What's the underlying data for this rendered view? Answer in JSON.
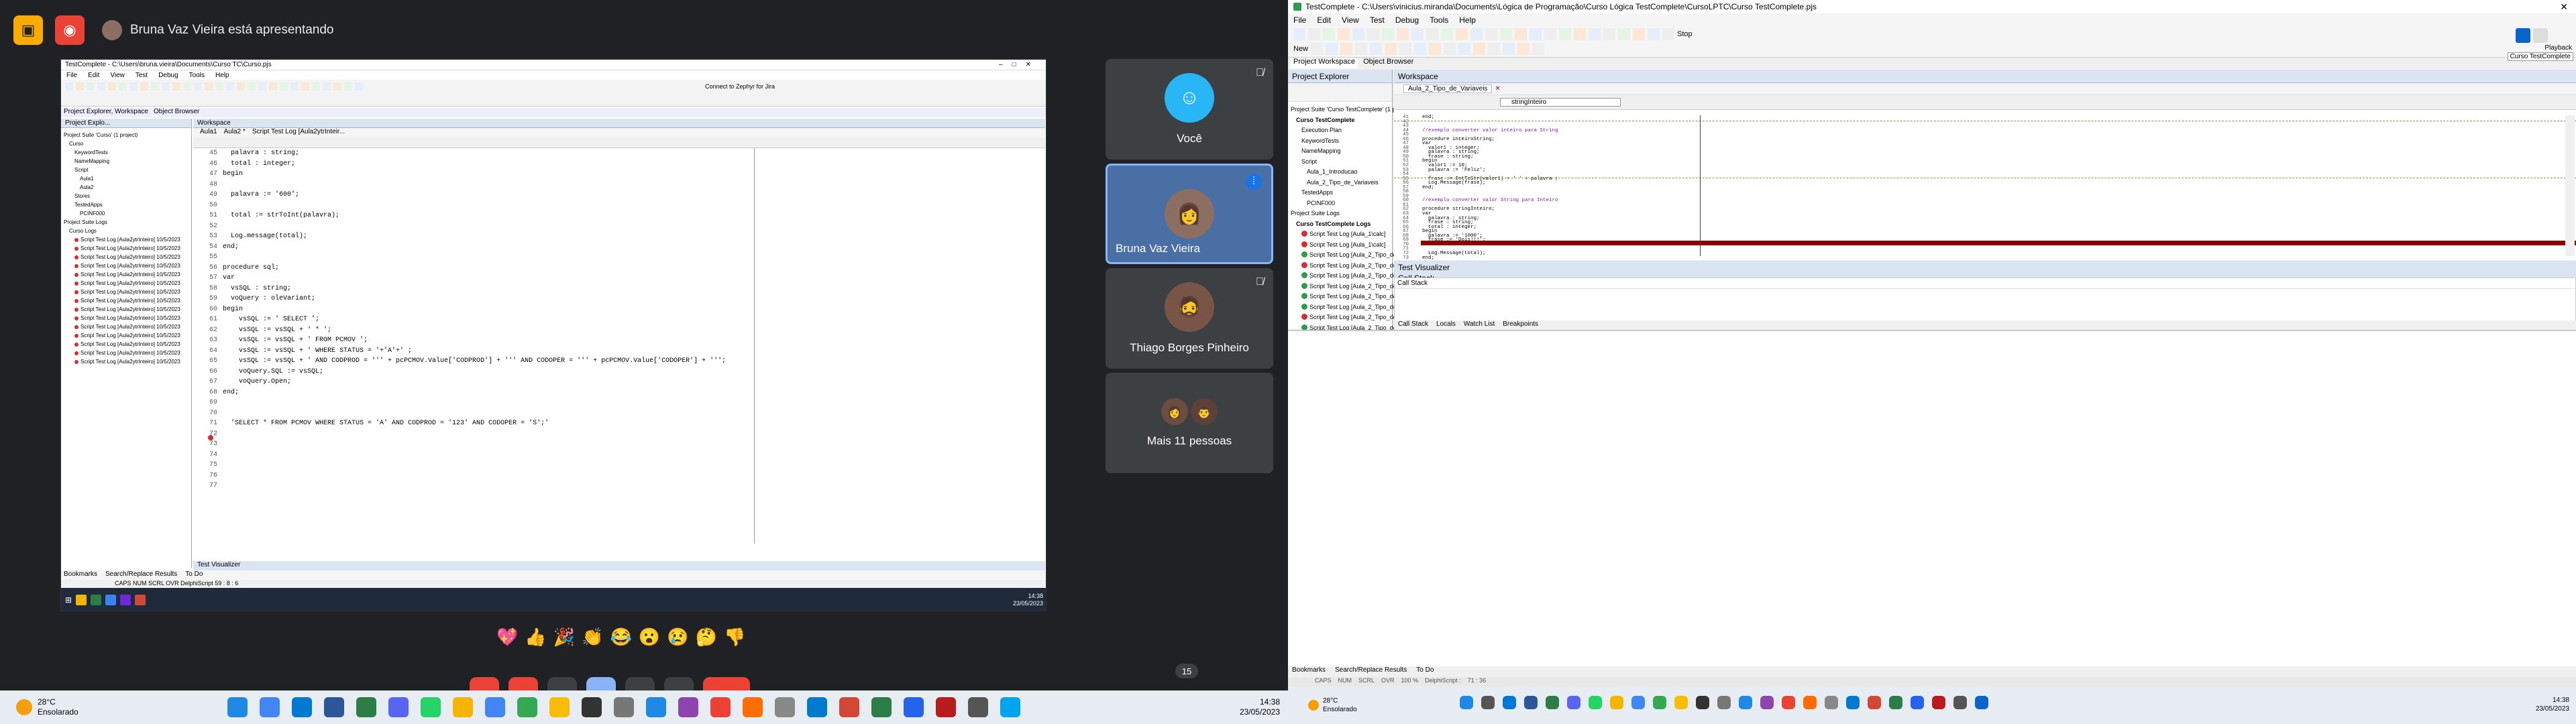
{
  "meet": {
    "presenter_text": "Bruna Vaz Vieira está apresentando",
    "tiles": [
      {
        "name": "Você",
        "muted": true
      },
      {
        "name": "Bruna Vaz Vieira",
        "muted": false
      },
      {
        "name": "Thiago Borges Pinheiro",
        "muted": true
      },
      {
        "name": "Mais 11 pessoas",
        "muted": false
      }
    ],
    "reactions": [
      "💖",
      "👍",
      "🎉",
      "👏",
      "😂",
      "😮",
      "😢",
      "🤔",
      "👎"
    ],
    "badge": "15"
  },
  "shared": {
    "title": "TestComplete - C:\\Users\\bruna.vieira\\Documents\\Curso TC\\Curso.pjs",
    "menu": [
      "File",
      "Edit",
      "View",
      "Test",
      "Debug",
      "Tools",
      "Help"
    ],
    "panel_left": "Project Explo...",
    "panel_right": "Workspace",
    "left_tabs": [
      "Project Explorer, Workspace",
      "Object Browser"
    ],
    "tabs": [
      "Aula1",
      "Aula2 *",
      "Script Test Log [Aula2ytrInteir..."
    ],
    "tree": [
      "Project Suite 'Curso' (1 project)",
      "Curso",
      "KeywordTests",
      "NameMapping",
      "Script",
      "Aula1",
      "Aula2",
      "Stores",
      "TestedApps",
      "PCINF000",
      "Project Suite Logs",
      "Curso Logs",
      "Script Test Log [Aula2ytrInteiro] 10/5/2023",
      "Script Test Log [Aula2ytrInteiro] 10/5/2023",
      "Script Test Log [Aula2ytrInteiro] 10/5/2023",
      "Script Test Log [Aula2ytrInteiro] 10/5/2023",
      "Script Test Log [Aula2ytrInteiro] 10/5/2023",
      "Script Test Log [Aula2ytrInteiro] 10/5/2023",
      "Script Test Log [Aula2ytrInteiro] 10/5/2023",
      "Script Test Log [Aula2ytrInteiro] 10/5/2023",
      "Script Test Log [Aula2ytrInteiro] 10/5/2023",
      "Script Test Log [Aula2ytrInteiro] 10/5/2023",
      "Script Test Log [Aula2ytrInteiro] 10/5/2023",
      "Script Test Log [Aula2ytrInteiro] 10/5/2023",
      "Script Test Log [Aula2ytrInteiro] 10/5/2023",
      "Script Test Log [Aula2ytrInteiro] 10/5/2023",
      "Script Test Log [Aula2ytrInteiro] 10/5/2023"
    ],
    "gutter": "45\n46\n47\n48\n49\n50\n51\n52\n53\n54\n55\n56\n57\n58\n59\n60\n61\n62\n63\n64\n65\n66\n67\n68\n69\n70\n71\n72\n73\n74\n75\n76\n77",
    "code": "  palavra : string;\n  total : integer;\nbegin\n\n  palavra := '600';\n\n  total := strToInt(palavra);\n\n  Log.message(total);\nend;\n\nprocedure sql;\nvar\n  vsSQL : string;\n  voQuery : oleVariant;\nbegin\n    vsSQL := ' SELECT ';\n    vsSQL := vsSQL + ' * ';\n    vsSQL := vsSQL + ' FROM PCMOV ';\n    vsSQL := vsSQL + ' WHERE STATUS = '+'A'+' ;\n    vsSQL := vsSQL + ' AND CODPROD = ''' + pcPCMOV.Value['CODPROD'] + ''' AND CODOPER = ''' + pcPCMOV.Value['CODOPER'] + ''';\n    voQuery.SQL := vsSQL;\n    voQuery.Open;\nend;\n\n\n  'SELECT * FROM PCMOV WHERE STATUS = 'A' AND CODPROD = '123' AND CODOPER = 'S';'\n\n\n\n",
    "bottom_tabs": [
      "Bookmarks",
      "Search/Replace Results",
      "To Do"
    ],
    "status": "CAPS  NUM  SCRL  OVR  DelphiScript  59 : 8 : 6",
    "visualizer": "Test Visualizer",
    "connect": "Connect to Zephyr for Jira",
    "time": "14:38",
    "date": "23/05/2023"
  },
  "testcomplete": {
    "title": "TestComplete - C:\\Users\\vinicius.miranda\\Documents\\Lógica de Programação\\Curso Lógica TestComplete\\CursoLPTC\\Curso TestComplete.pjs",
    "menu": [
      "File",
      "Edit",
      "View",
      "Test",
      "Debug",
      "Tools",
      "Help"
    ],
    "new_label": "New",
    "stop_label": "Stop",
    "left_tabs": [
      "Project Workspace",
      "Object Browser"
    ],
    "project_explorer": "Project Explorer",
    "workspace": "Workspace",
    "tab": "Aula_2_Tipo_de_Variaveis",
    "routine": "stringInteiro",
    "tree": [
      "Project Suite 'Curso TestComplete' (1 pr",
      "Curso TestComplete",
      "Execution Plan",
      "KeywordTests",
      "NameMapping",
      "Script",
      "Aula_1_Introducao",
      "Aula_2_Tipo_de_Variaveis",
      "TestedApps",
      "PCINF000",
      "Project Suite Logs",
      "Curso TestComplete Logs",
      "Script Test Log [Aula_1\\calc]",
      "Script Test Log [Aula_1\\calc]",
      "Script Test Log [Aula_2_Tipo_de",
      "Script Test Log [Aula_2_Tipo_de",
      "Script Test Log [Aula_2_Tipo_de",
      "Script Test Log [Aula_2_Tipo_de",
      "Script Test Log [Aula_2_Tipo_de",
      "Script Test Log [Aula_2_Tipo_de",
      "Script Test Log [Aula_2_Tipo_de",
      "Script Test Log [Aula_2_Tipo_de",
      "Script Test Log [Aula_2_Tipo_de",
      "Script Test Log [Aula_2_Tipo_de"
    ],
    "gutter": "41\n42\n43\n44\n45\n46\n47\n48\n49\n50\n51\n52\n53\n54\n55\n56\n57\n58\n59\n60\n61\n62\n63\n64\n65\n66\n67\n68\n69\n70\n71\n72\n73",
    "code": "end;\n\n\n//exemplo converter valor inteiro para String\n\nprocedure inteiroString;\nvar\n  valor1 : integer;\n  palavra : string;\n  frase : string;\nbegin\n  valor1 := 10;\n  palavra := 'Feliz';\n\n  frase := IntToStr(valor1) + ' ' + palavra ;\n  Log.Message(frase);\nend;\n\n\n//exemplo converter valor String para Inteiro\n\nprocedure stringInteiro;\nvar\n  palavra : string;\n  frase : string;\n  total : integer;\nbegin\n  palavra := '1000';\n  frase := 'Dois!!!';\n\n  total := StrToInt(palavra) + ' ' + frase;\n  Log.Message(total);\nend;",
    "highlight_line": 71,
    "test_visualizer": "Test Visualizer",
    "call_stack": "Call Stack",
    "call_stack_header": "Call Stack",
    "debug_tabs": [
      "Call Stack",
      "Locals",
      "Watch List",
      "Breakpoints"
    ],
    "bottom_tabs": [
      "Bookmarks",
      "Search/Replace Results",
      "To Do"
    ],
    "status": [
      "CAPS",
      "NUM",
      "SCRL",
      "OVR",
      "100 %",
      "DelphiScript :",
      "71 : 36"
    ],
    "playback": "Playback",
    "tooltip": "Curso TestComplete"
  },
  "taskbar_left": {
    "temp": "28°C",
    "weather": "Ensolarado",
    "time": "14:38",
    "date": "23/05/2023"
  },
  "taskbar_right": {
    "temp": "28°C",
    "weather": "Ensolarado",
    "time": "14:38",
    "date": "23/05/2023"
  },
  "colors": {
    "accent": "#0a63c9",
    "breakpoint": "#8b0000",
    "meet_bg": "#202124",
    "end_call": "#ea4335"
  }
}
